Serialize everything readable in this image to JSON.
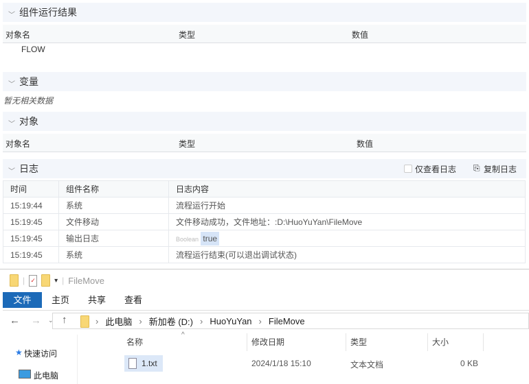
{
  "results": {
    "title": "组件运行结果",
    "columns": [
      "对象名",
      "类型",
      "数值"
    ],
    "rows": [
      "FLOW"
    ]
  },
  "variables": {
    "title": "变量",
    "empty": "暂无相关数据"
  },
  "objects": {
    "title": "对象",
    "columns": [
      "对象名",
      "类型",
      "数值"
    ]
  },
  "log": {
    "title": "日志",
    "only_log_label": "仅查看日志",
    "only_log_checked": false,
    "copy_label": "复制日志",
    "columns": [
      "时间",
      "组件名称",
      "日志内容"
    ],
    "rows": [
      {
        "time": "15:19:44",
        "component": "系统",
        "content": "流程运行开始"
      },
      {
        "time": "15:19:45",
        "component": "文件移动",
        "content": "文件移动成功，文件地址：:D:\\HuoYuYan\\FileMove"
      },
      {
        "time": "15:19:45",
        "component": "输出日志",
        "tag": "Boolean",
        "content": "true"
      },
      {
        "time": "15:19:45",
        "component": "系统",
        "content": "流程运行结束(可以退出调试状态)"
      }
    ]
  },
  "explorer": {
    "title": "FileMove",
    "tabs": [
      "文件",
      "主页",
      "共享",
      "查看"
    ],
    "breadcrumb": [
      "此电脑",
      "新加卷 (D:)",
      "HuoYuYan",
      "FileMove"
    ],
    "sidebar": [
      "快速访问",
      "此电脑"
    ],
    "columns": [
      "名称",
      "修改日期",
      "类型",
      "大小"
    ],
    "files": [
      {
        "name": "1.txt",
        "date": "2024/1/18 15:10",
        "type": "文本文档",
        "size": "0 KB"
      }
    ],
    "accent": "#1c6ab8"
  }
}
